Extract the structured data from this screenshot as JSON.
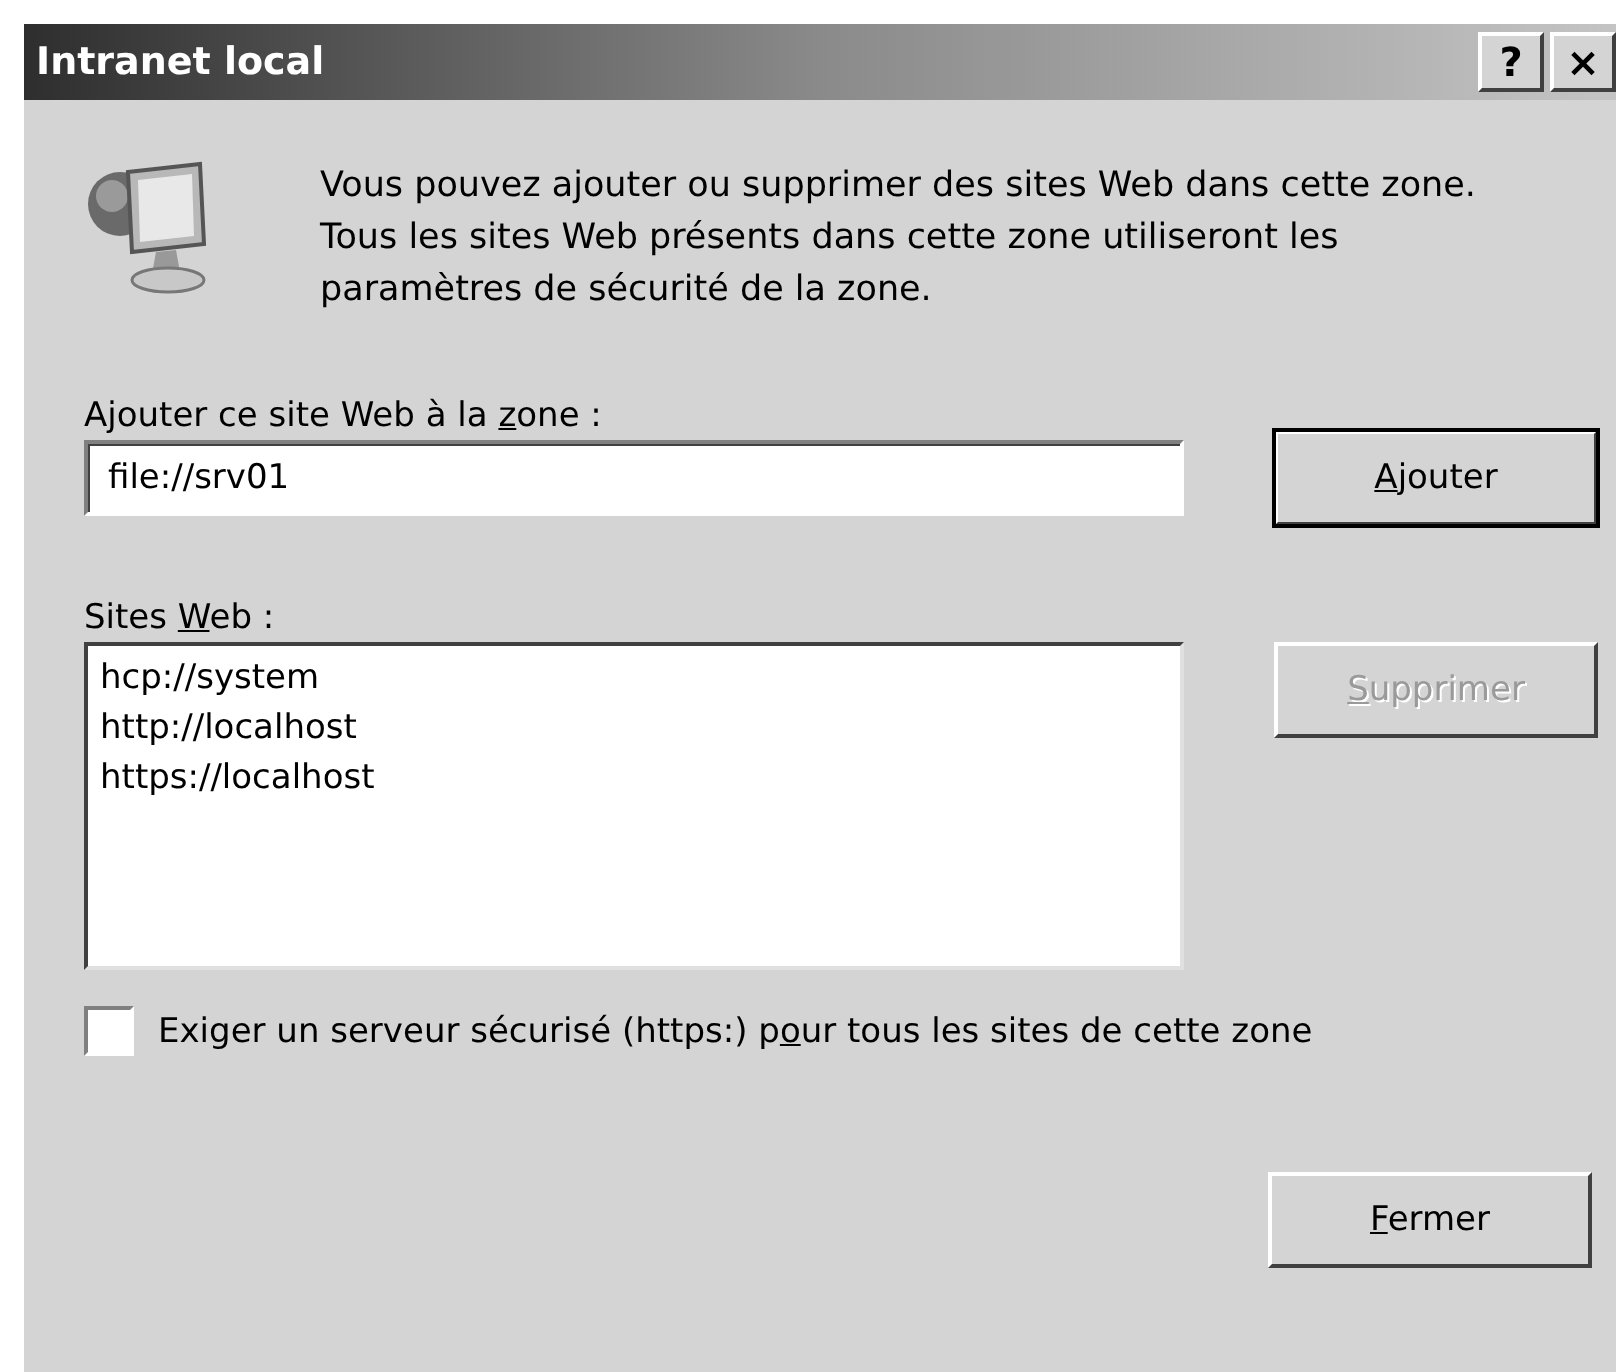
{
  "window": {
    "title": "Intranet local",
    "title_buttons": [
      "?",
      "×"
    ]
  },
  "intro": "Vous pouvez ajouter ou supprimer des sites Web dans cette zone. Tous les sites Web présents dans cette zone utiliseront les paramètres de sécurité de la zone.",
  "add_field": {
    "label": {
      "before": "Ajouter ce site Web à la ",
      "key": "z",
      "after": "one :"
    },
    "value": "file://srv01"
  },
  "add_button": {
    "label": {
      "key": "A",
      "after": "jouter"
    },
    "disabled": false,
    "default": true
  },
  "sites": {
    "label": {
      "before": "Sites ",
      "key": "W",
      "after": "eb :"
    },
    "items": [
      {
        "text": "hcp://system",
        "selected": false
      },
      {
        "text": "http://localhost",
        "selected": false
      },
      {
        "text": "https://localhost",
        "selected": false
      }
    ]
  },
  "remove_button": {
    "label": {
      "key": "S",
      "after": "upprimer"
    },
    "disabled": true,
    "default": false
  },
  "require_https": {
    "label": {
      "before": "Exiger un serveur sécurisé (https:) p",
      "key": "o",
      "after": "ur tous les sites de cette zone"
    },
    "checked": false
  },
  "close_button": {
    "label": {
      "key": "F",
      "after": "ermer"
    },
    "disabled": false,
    "default": false
  }
}
